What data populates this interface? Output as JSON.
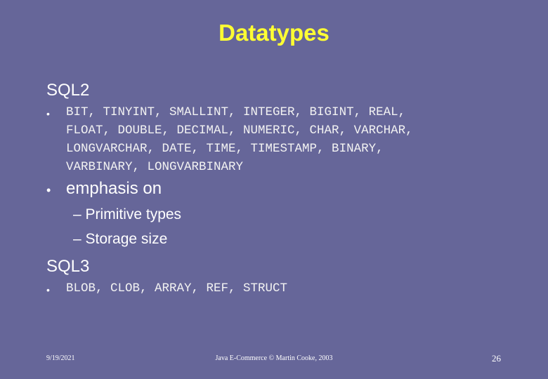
{
  "slide": {
    "title": "Datatypes",
    "sections": [
      {
        "heading": "SQL2",
        "bullet": "BIT, TINYINT, SMALLINT, INTEGER, BIGINT, REAL,",
        "bullet_lines": [
          "BIT, TINYINT, SMALLINT, INTEGER, BIGINT, REAL,",
          "FLOAT, DOUBLE, DECIMAL, NUMERIC, CHAR, VARCHAR,",
          "LONGVARCHAR, DATE, TIME, TIMESTAMP, BINARY,",
          "VARBINARY, LONGVARBINARY"
        ],
        "point": "emphasis on",
        "subpoints": [
          "Primitive types",
          "Storage size"
        ]
      },
      {
        "heading": "SQL3",
        "bullet_lines": [
          "BLOB, CLOB, ARRAY, REF, STRUCT"
        ]
      }
    ],
    "bullet_glyph": "•",
    "dash_glyph": "–"
  },
  "footer": {
    "date": "9/19/2021",
    "center": "Java E-Commerce © Martin Cooke, 2003",
    "page_number": "26"
  },
  "colors": {
    "background": "#666699",
    "title": "#ffff33",
    "text": "#ffffff"
  }
}
